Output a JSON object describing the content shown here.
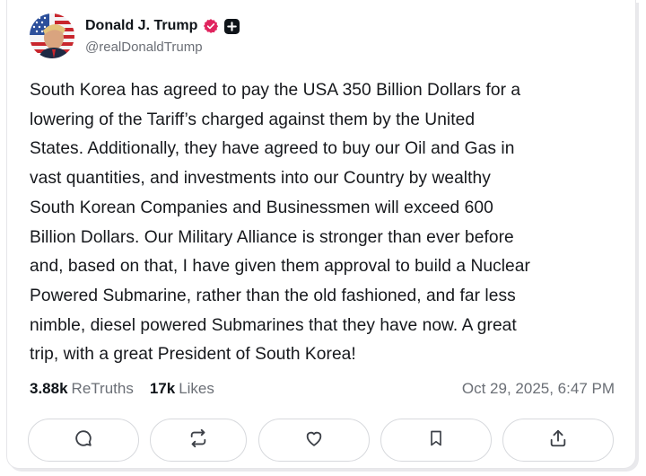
{
  "author": {
    "display_name": "Donald J. Trump",
    "handle": "@realDonaldTrump",
    "avatar_icon": "avatar-flag-portrait",
    "verified_icon": "verified-badge-icon",
    "verified_color": "#e0245e",
    "plus_icon": "plus-badge-icon"
  },
  "post": {
    "text": "South Korea has agreed to pay the USA 350 Billion Dollars for a\nlowering of the Tariff’s charged against them by the United\nStates. Additionally, they have agreed to buy our Oil and Gas in\nvast quantities, and investments into our Country by wealthy\nSouth Korean Companies and Businessmen will exceed 600\nBillion Dollars. Our Military Alliance is stronger than ever before\nand, based on that, I have given them approval to build a Nuclear\nPowered Submarine, rather than the old fashioned, and far less\nnimble, diesel powered Submarines that they have now. A great\ntrip, with a great President of South Korea!"
  },
  "stats": {
    "retruths_count": "3.88k",
    "retruths_label": "ReTruths",
    "likes_count": "17k",
    "likes_label": "Likes",
    "timestamp": "Oct 29, 2025, 6:47 PM"
  },
  "actions": [
    {
      "icon": "comment-icon"
    },
    {
      "icon": "retruth-icon"
    },
    {
      "icon": "like-heart-icon"
    },
    {
      "icon": "bookmark-icon"
    },
    {
      "icon": "share-icon"
    }
  ]
}
